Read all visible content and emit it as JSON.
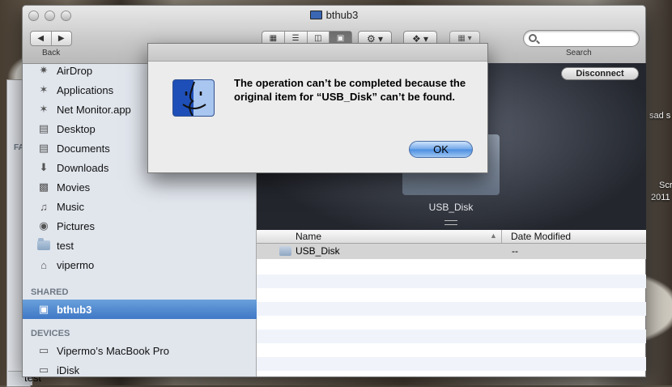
{
  "window": {
    "title": "bthub3"
  },
  "toolbar": {
    "back_label": "Back",
    "search_label": "Search",
    "search_placeholder": "",
    "view_buttons": [
      "icon-view",
      "list-view",
      "column-view",
      "coverflow-view"
    ],
    "selected_view": "coverflow-view"
  },
  "sidebar": {
    "favorites_header": "FA",
    "items": [
      {
        "label": "AirDrop",
        "icon": "airdrop-icon"
      },
      {
        "label": "Applications",
        "icon": "applications-icon"
      },
      {
        "label": "Net Monitor.app",
        "icon": "app-icon"
      },
      {
        "label": "Desktop",
        "icon": "desktop-icon"
      },
      {
        "label": "Documents",
        "icon": "documents-icon"
      },
      {
        "label": "Downloads",
        "icon": "downloads-icon"
      },
      {
        "label": "Movies",
        "icon": "movies-icon"
      },
      {
        "label": "Music",
        "icon": "music-icon"
      },
      {
        "label": "Pictures",
        "icon": "pictures-icon"
      },
      {
        "label": "test",
        "icon": "folder-icon"
      },
      {
        "label": "vipermo",
        "icon": "home-icon"
      }
    ],
    "shared_header": "SHARED",
    "shared_items": [
      {
        "label": "bthub3",
        "icon": "computer-icon",
        "selected": true
      }
    ],
    "devices_header": "DEVICES",
    "device_items": [
      {
        "label": "Vipermo’s MacBook Pro",
        "icon": "laptop-icon"
      },
      {
        "label": "iDisk",
        "icon": "idisk-icon"
      }
    ]
  },
  "content": {
    "disconnect_label": "Disconnect",
    "preview_label": "USB_Disk",
    "columns": {
      "name": "Name",
      "date": "Date Modified"
    },
    "rows": [
      {
        "name": "USB_Disk",
        "date": "--"
      }
    ]
  },
  "dialog": {
    "message": "The operation can’t be completed because the original item for “USB_Disk” can’t be found.",
    "ok_label": "OK"
  },
  "desktop": {
    "text_1": "sad s",
    "text_2": "Scr",
    "text_3": "2011",
    "back_window_label": "test"
  }
}
